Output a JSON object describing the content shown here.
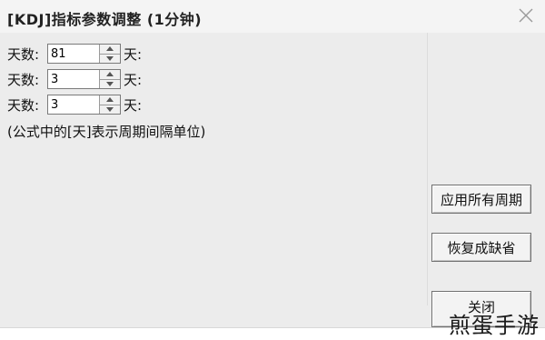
{
  "dialog": {
    "title": "[KDJ]指标参数调整 (1分钟)"
  },
  "params": [
    {
      "label": "天数:",
      "value": "81",
      "unit": "天:"
    },
    {
      "label": "天数:",
      "value": "3",
      "unit": "天:"
    },
    {
      "label": "天数:",
      "value": "3",
      "unit": "天:"
    }
  ],
  "note": "(公式中的[天]表示周期间隔单位)",
  "buttons": {
    "apply_all_periods": "应用所有周期",
    "restore_defaults": "恢复成缺省",
    "close": "关闭"
  },
  "watermark": "煎蛋手游",
  "icons": {
    "close": "close-icon",
    "spin_up": "spin-up-icon",
    "spin_down": "spin-down-icon"
  }
}
